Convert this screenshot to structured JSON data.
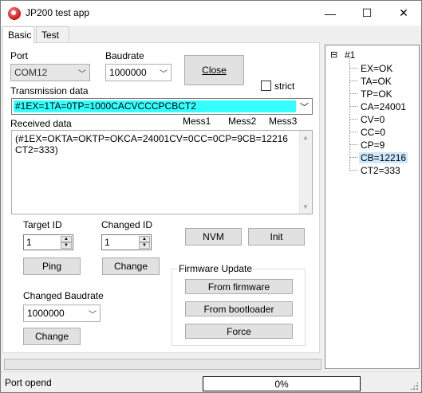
{
  "window": {
    "title": "JP200 test app",
    "minimize_glyph": "—",
    "maximize_glyph": "☐",
    "close_glyph": "✕"
  },
  "tabs": [
    {
      "label": "Basic",
      "active": true
    },
    {
      "label": "Test",
      "active": false
    }
  ],
  "basic": {
    "port_label": "Port",
    "port_value": "COM12",
    "baudrate_label": "Baudrate",
    "baudrate_value": "1000000",
    "close_button": "Close",
    "strict_label": "strict",
    "strict_checked": false,
    "transmission_label": "Transmission data",
    "transmission_value": "#1EX=1TA=0TP=1000CACVCCCPCBCT2",
    "received_label": "Received data",
    "mess_labels": [
      "Mess1",
      "Mess2",
      "Mess3"
    ],
    "received_text": "(#1EX=OKTA=OKTP=OKCA=24001CV=0CC=0CP=9CB=12216CT2=333)",
    "target_id_label": "Target ID",
    "target_id_value": "1",
    "changed_id_label": "Changed ID",
    "changed_id_value": "1",
    "nvm_button": "NVM",
    "init_button": "Init",
    "ping_button": "Ping",
    "change_id_button": "Change",
    "changed_baudrate_label": "Changed Baudrate",
    "changed_baudrate_value": "1000000",
    "change_baud_button": "Change",
    "firmware_group_label": "Firmware Update",
    "from_firmware_button": "From firmware",
    "from_bootloader_button": "From bootloader",
    "force_button": "Force"
  },
  "tree": {
    "root": "#1",
    "expander": "⊟",
    "children": [
      "EX=OK",
      "TA=OK",
      "TP=OK",
      "CA=24001",
      "CV=0",
      "CC=0",
      "CP=9",
      "CB=12216",
      "CT2=333"
    ],
    "selected_index": 7
  },
  "status": {
    "text": "Port opend",
    "progress_text": "0%",
    "progress_value": 0
  },
  "colors": {
    "transmission_highlight": "#33ffff",
    "tree_selected": "#cce8ff"
  }
}
